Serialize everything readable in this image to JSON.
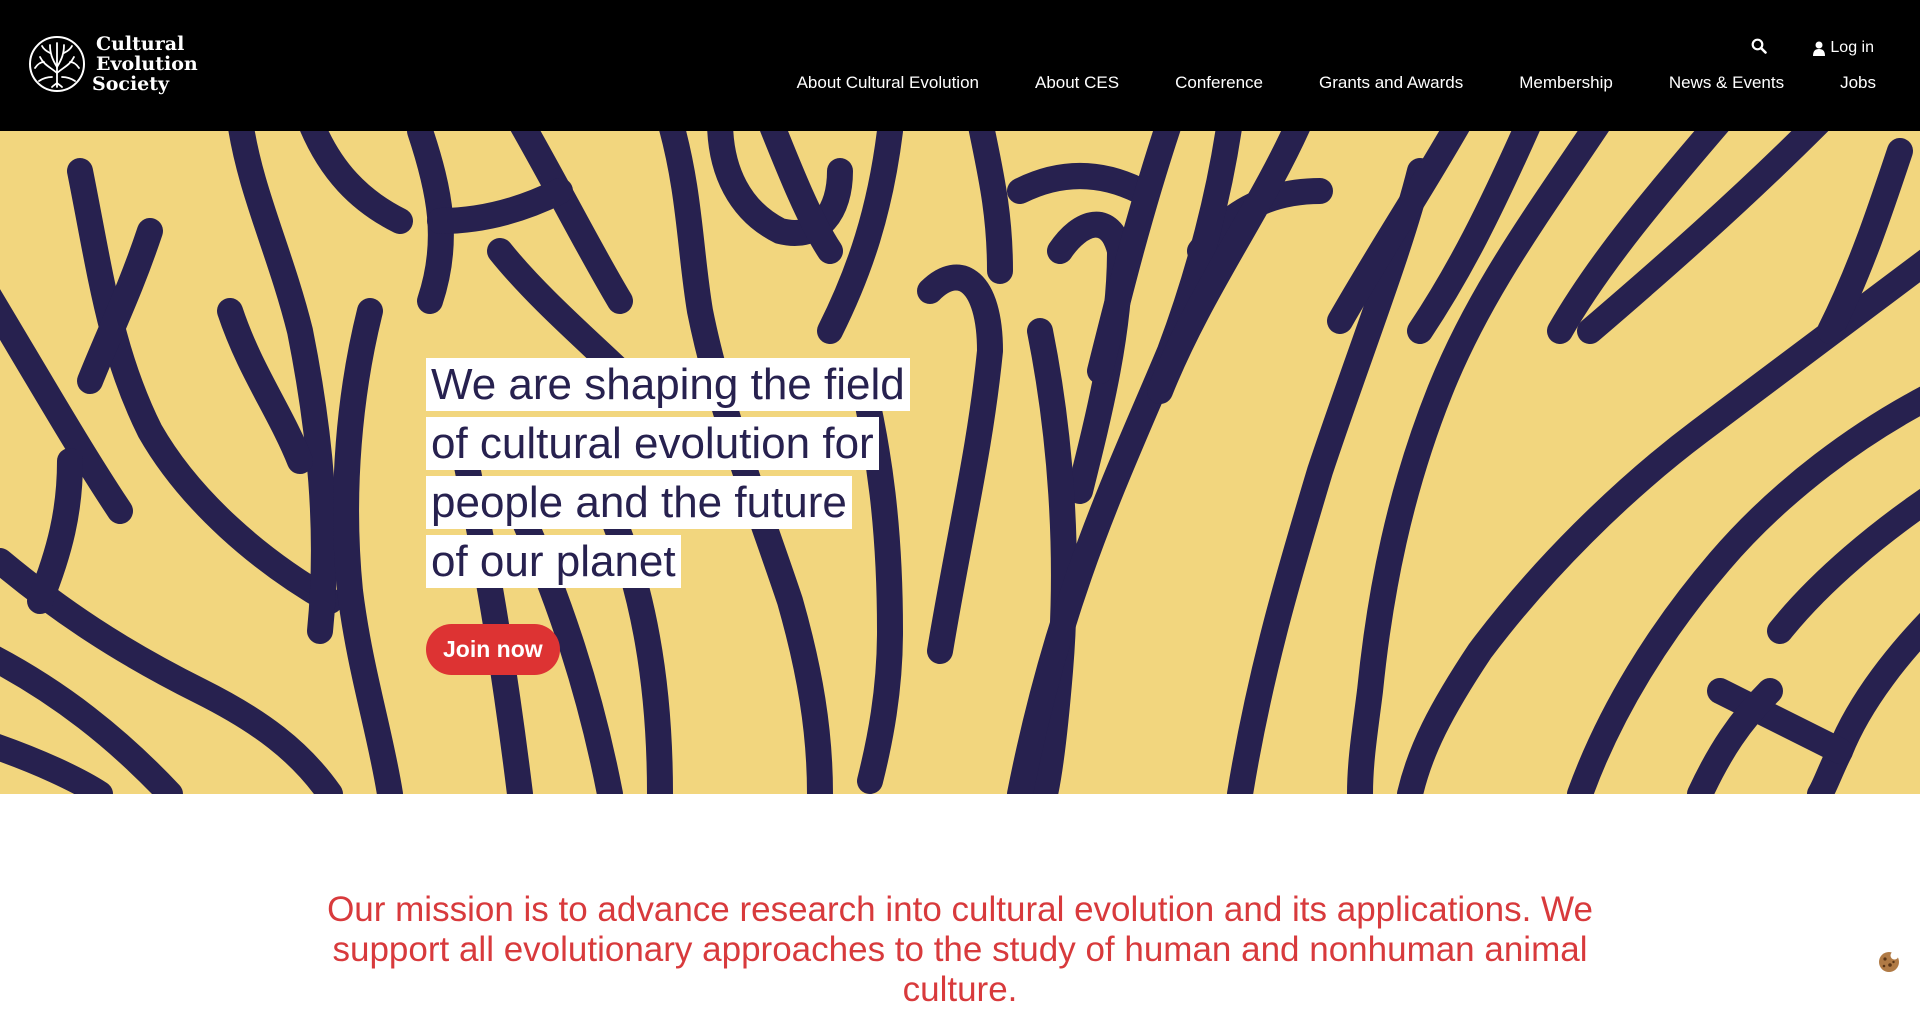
{
  "brand": {
    "name_line1": "Cultural",
    "name_line2": "Evolution",
    "name_line3": "Society"
  },
  "header": {
    "search_icon": "search-icon",
    "login_label": "Log in",
    "nav": [
      {
        "label": "About Cultural Evolution"
      },
      {
        "label": "About CES"
      },
      {
        "label": "Conference"
      },
      {
        "label": "Grants and Awards"
      },
      {
        "label": "Membership"
      },
      {
        "label": "News & Events"
      },
      {
        "label": "Jobs"
      }
    ]
  },
  "hero": {
    "headline_lines": [
      "We are shaping the field",
      "of cultural evolution for",
      "people and the future",
      "of our planet"
    ],
    "cta_label": "Join now"
  },
  "mission": {
    "text": "Our mission is to advance research into cultural evolution and its applications. We support all evolutionary approaches to the study of human and nonhuman animal culture."
  },
  "colors": {
    "header_bg": "#000000",
    "hero_bg": "#f2d67e",
    "pattern": "#27214f",
    "accent_red": "#dd3333",
    "mission_text": "#d83a3c"
  }
}
